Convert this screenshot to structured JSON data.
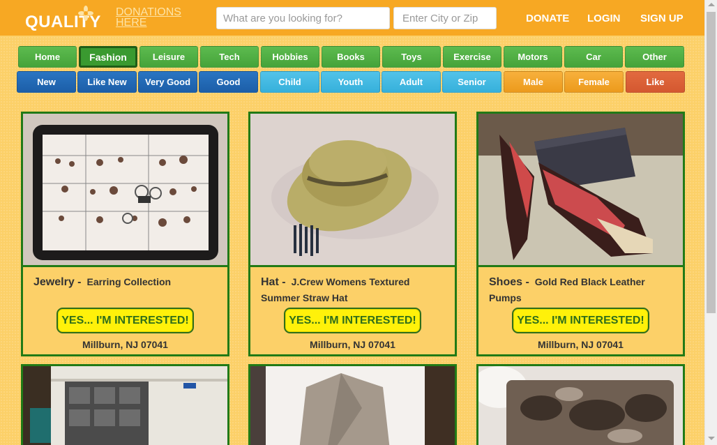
{
  "header": {
    "logo_main": "QUALITY",
    "logo_sub_line1": "DONATIONS",
    "logo_sub_line2": "HERE",
    "search_placeholder": "What are you looking for?",
    "city_placeholder": "Enter City or Zip",
    "links": [
      "DONATE",
      "LOGIN",
      "SIGN UP"
    ]
  },
  "categories": [
    "Home",
    "Fashion",
    "Leisure",
    "Tech",
    "Hobbies",
    "Books",
    "Toys",
    "Exercise",
    "Motors",
    "Car",
    "Other"
  ],
  "active_category": "Fashion",
  "filters": [
    "New",
    "Like New",
    "Very Good",
    "Good",
    "Child",
    "Youth",
    "Adult",
    "Senior",
    "Male",
    "Female",
    "Like"
  ],
  "cards": [
    {
      "category": "Jewelry -",
      "name": "Earring Collection",
      "button": "YES... I'M INTERESTED!",
      "location": "Millburn, NJ 07041"
    },
    {
      "category": "Hat -",
      "name": "J.Crew Womens Textured Summer Straw Hat",
      "button": "YES... I'M INTERESTED!",
      "location": "Millburn, NJ 07041"
    },
    {
      "category": "Shoes -",
      "name": "Gold Red Black Leather Pumps",
      "button": "YES... I'M INTERESTED!",
      "location": "Millburn, NJ 07041"
    }
  ],
  "colors": {
    "header": "#f7a823",
    "background": "#fcd068",
    "card_border": "#217a16",
    "button_yellow": "#fff10a"
  }
}
